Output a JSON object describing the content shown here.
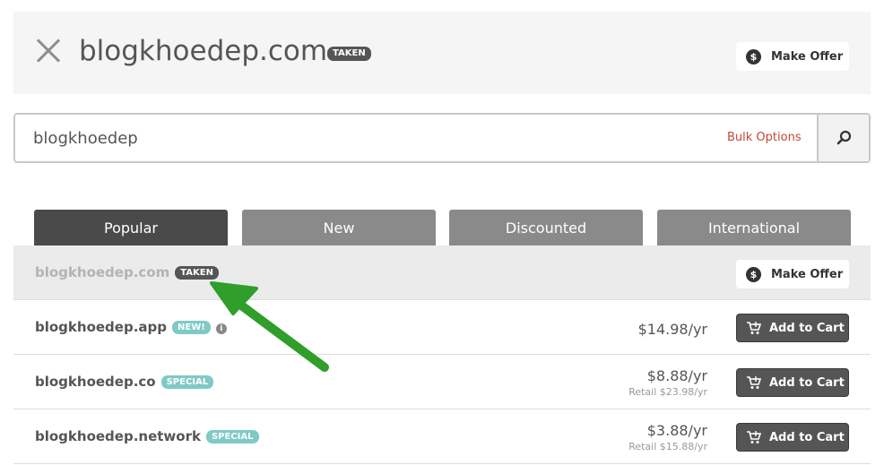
{
  "header": {
    "domain": "blogkhoedep.com",
    "status_badge": "TAKEN",
    "offer_label": "Make Offer",
    "offer_icon": "$"
  },
  "search": {
    "value": "blogkhoedep",
    "bulk_label": "Bulk Options"
  },
  "tabs": [
    {
      "label": "Popular",
      "active": true
    },
    {
      "label": "New",
      "active": false
    },
    {
      "label": "Discounted",
      "active": false
    },
    {
      "label": "International",
      "active": false
    }
  ],
  "results": [
    {
      "domain": "blogkhoedep.com",
      "badge": "TAKEN",
      "action": "Make Offer",
      "action_icon": "$"
    },
    {
      "domain": "blogkhoedep.app",
      "badge": "NEW!",
      "info_icon": "i",
      "price": "$14.98/yr",
      "action": "Add to Cart"
    },
    {
      "domain": "blogkhoedep.co",
      "badge": "SPECIAL",
      "price": "$8.88/yr",
      "retail": "Retail $23.98/yr",
      "action": "Add to Cart"
    },
    {
      "domain": "blogkhoedep.network",
      "badge": "SPECIAL",
      "price": "$3.88/yr",
      "retail": "Retail $15.88/yr",
      "action": "Add to Cart"
    }
  ],
  "colors": {
    "accent_link": "#c4463a",
    "tab_active": "#4a4a4a",
    "tab_inactive": "#8a8a8a",
    "badge_special": "#7fc9c6",
    "annotation_arrow": "#2f9e2a"
  },
  "icons": {
    "close": "close-icon",
    "search": "magnifier-icon",
    "cart": "cart-icon",
    "info": "info-icon",
    "offer": "dollar-icon"
  }
}
